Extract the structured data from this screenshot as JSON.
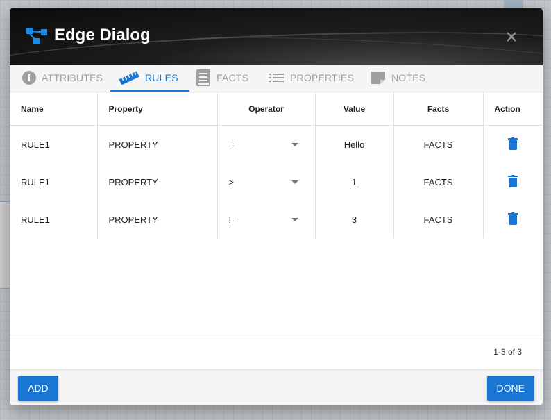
{
  "dialog": {
    "title": "Edge Dialog",
    "icon": "edge-graph-icon"
  },
  "tabs": [
    {
      "label": "ATTRIBUTES",
      "icon": "info-icon",
      "active": false
    },
    {
      "label": "RULES",
      "icon": "ruler-icon",
      "active": true
    },
    {
      "label": "FACTS",
      "icon": "book-icon",
      "active": false
    },
    {
      "label": "PROPERTIES",
      "icon": "list-icon",
      "active": false
    },
    {
      "label": "NOTES",
      "icon": "note-icon",
      "active": false
    }
  ],
  "table": {
    "headers": [
      "Name",
      "Property",
      "Operator",
      "Value",
      "Facts",
      "Action"
    ],
    "rows": [
      {
        "name": "RULE1",
        "property": "PROPERTY",
        "operator": "=",
        "value": "Hello",
        "facts": "FACTS",
        "action": "delete-icon"
      },
      {
        "name": "RULE1",
        "property": "PROPERTY",
        "operator": ">",
        "value": "1",
        "facts": "FACTS",
        "action": "delete-icon"
      },
      {
        "name": "RULE1",
        "property": "PROPERTY",
        "operator": "!=",
        "value": "3",
        "facts": "FACTS",
        "action": "delete-icon"
      }
    ]
  },
  "pagination": "1-3 of 3",
  "buttons": {
    "add": "ADD",
    "done": "DONE"
  },
  "colors": {
    "accent": "#1976d2",
    "header_bg": "#1a1a1a",
    "inactive_tab": "#9e9e9e"
  }
}
